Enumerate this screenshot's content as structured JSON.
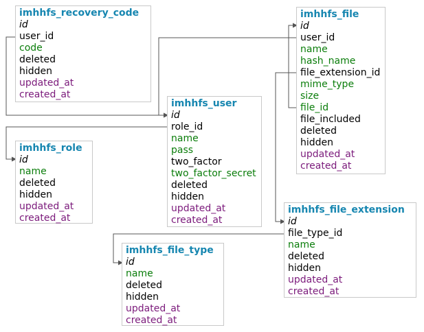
{
  "colors": {
    "title": "#1686b0",
    "pk": "#000000",
    "fk": "#000000",
    "data": "#0a7d0a",
    "hidden": "#000000",
    "timestamp": "#7b1a7b",
    "border": "#c8c8c8",
    "connector": "#555555"
  },
  "tables": {
    "recovery_code": {
      "title": "imhhfs_recovery_code",
      "fields": [
        {
          "name": "id",
          "kind": "pk"
        },
        {
          "name": "user_id",
          "kind": "fk"
        },
        {
          "name": "code",
          "kind": "data"
        },
        {
          "name": "deleted",
          "kind": "hidden"
        },
        {
          "name": "hidden",
          "kind": "hidden"
        },
        {
          "name": "updated_at",
          "kind": "timestamp"
        },
        {
          "name": "created_at",
          "kind": "timestamp"
        }
      ]
    },
    "file": {
      "title": "imhhfs_file",
      "fields": [
        {
          "name": "id",
          "kind": "pk"
        },
        {
          "name": "user_id",
          "kind": "fk"
        },
        {
          "name": "name",
          "kind": "data"
        },
        {
          "name": "hash_name",
          "kind": "data"
        },
        {
          "name": "file_extension_id",
          "kind": "fk"
        },
        {
          "name": "mime_type",
          "kind": "data"
        },
        {
          "name": "size",
          "kind": "data"
        },
        {
          "name": "file_id",
          "kind": "data"
        },
        {
          "name": "file_included",
          "kind": "hidden"
        },
        {
          "name": "deleted",
          "kind": "hidden"
        },
        {
          "name": "hidden",
          "kind": "hidden"
        },
        {
          "name": "updated_at",
          "kind": "timestamp"
        },
        {
          "name": "created_at",
          "kind": "timestamp"
        }
      ]
    },
    "user": {
      "title": "imhhfs_user",
      "fields": [
        {
          "name": "id",
          "kind": "pk"
        },
        {
          "name": "role_id",
          "kind": "fk"
        },
        {
          "name": "name",
          "kind": "data"
        },
        {
          "name": "pass",
          "kind": "data"
        },
        {
          "name": "two_factor",
          "kind": "hidden"
        },
        {
          "name": "two_factor_secret",
          "kind": "data"
        },
        {
          "name": "deleted",
          "kind": "hidden"
        },
        {
          "name": "hidden",
          "kind": "hidden"
        },
        {
          "name": "updated_at",
          "kind": "timestamp"
        },
        {
          "name": "created_at",
          "kind": "timestamp"
        }
      ]
    },
    "role": {
      "title": "imhhfs_role",
      "fields": [
        {
          "name": "id",
          "kind": "pk"
        },
        {
          "name": "name",
          "kind": "data"
        },
        {
          "name": "deleted",
          "kind": "hidden"
        },
        {
          "name": "hidden",
          "kind": "hidden"
        },
        {
          "name": "updated_at",
          "kind": "timestamp"
        },
        {
          "name": "created_at",
          "kind": "timestamp"
        }
      ]
    },
    "file_extension": {
      "title": "imhhfs_file_extension",
      "fields": [
        {
          "name": "id",
          "kind": "pk"
        },
        {
          "name": "file_type_id",
          "kind": "fk"
        },
        {
          "name": "name",
          "kind": "data"
        },
        {
          "name": "deleted",
          "kind": "hidden"
        },
        {
          "name": "hidden",
          "kind": "hidden"
        },
        {
          "name": "updated_at",
          "kind": "timestamp"
        },
        {
          "name": "created_at",
          "kind": "timestamp"
        }
      ]
    },
    "file_type": {
      "title": "imhhfs_file_type",
      "fields": [
        {
          "name": "id",
          "kind": "pk"
        },
        {
          "name": "name",
          "kind": "data"
        },
        {
          "name": "deleted",
          "kind": "hidden"
        },
        {
          "name": "hidden",
          "kind": "hidden"
        },
        {
          "name": "updated_at",
          "kind": "timestamp"
        },
        {
          "name": "created_at",
          "kind": "timestamp"
        }
      ]
    }
  }
}
